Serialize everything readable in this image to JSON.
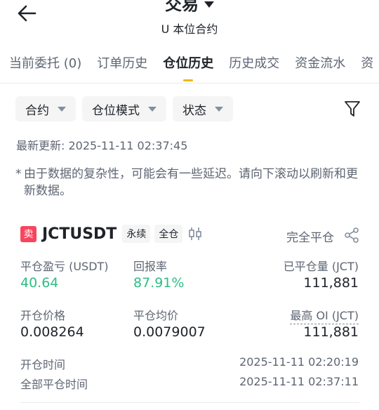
{
  "header": {
    "title": "交易",
    "subtitle": "U 本位合约"
  },
  "tabs": [
    {
      "label": "当前委托 (0)"
    },
    {
      "label": "订单历史"
    },
    {
      "label": "仓位历史"
    },
    {
      "label": "历史成交"
    },
    {
      "label": "资金流水"
    },
    {
      "label": "资"
    }
  ],
  "filters": [
    {
      "label": "合约"
    },
    {
      "label": "仓位模式"
    },
    {
      "label": "状态"
    }
  ],
  "updated": "最新更新: 2025-11-11 02:37:45",
  "note": {
    "star": "*",
    "text": "由于数据的复杂性，可能会有一些延迟。请向下滚动以刷新和更新数据。"
  },
  "position": {
    "side": "卖",
    "symbol": "JCTUSDT",
    "tags": [
      "永续",
      "全仓"
    ],
    "close_all_label": "完全平仓",
    "pnl_label": "平仓盈亏 (USDT)",
    "pnl_value": "40.64",
    "roi_label": "回报率",
    "roi_value": "87.91%",
    "closed_qty_label": "已平仓量 (JCT)",
    "closed_qty_value": "111,881",
    "entry_price_label": "开仓价格",
    "entry_price_value": "0.008264",
    "avg_close_label": "平仓均价",
    "avg_close_value": "0.0079007",
    "max_oi_label": "最高 OI (JCT)",
    "max_oi_value": "111,881",
    "open_time_label": "开仓时间",
    "open_time_value": "2025-11-11 02:20:19",
    "close_time_label": "全部平仓时间",
    "close_time_value": "2025-11-11 02:37:11"
  },
  "colors": {
    "accent": "#f0b90b",
    "profit": "#2ebd85",
    "sell": "#f6465d"
  }
}
